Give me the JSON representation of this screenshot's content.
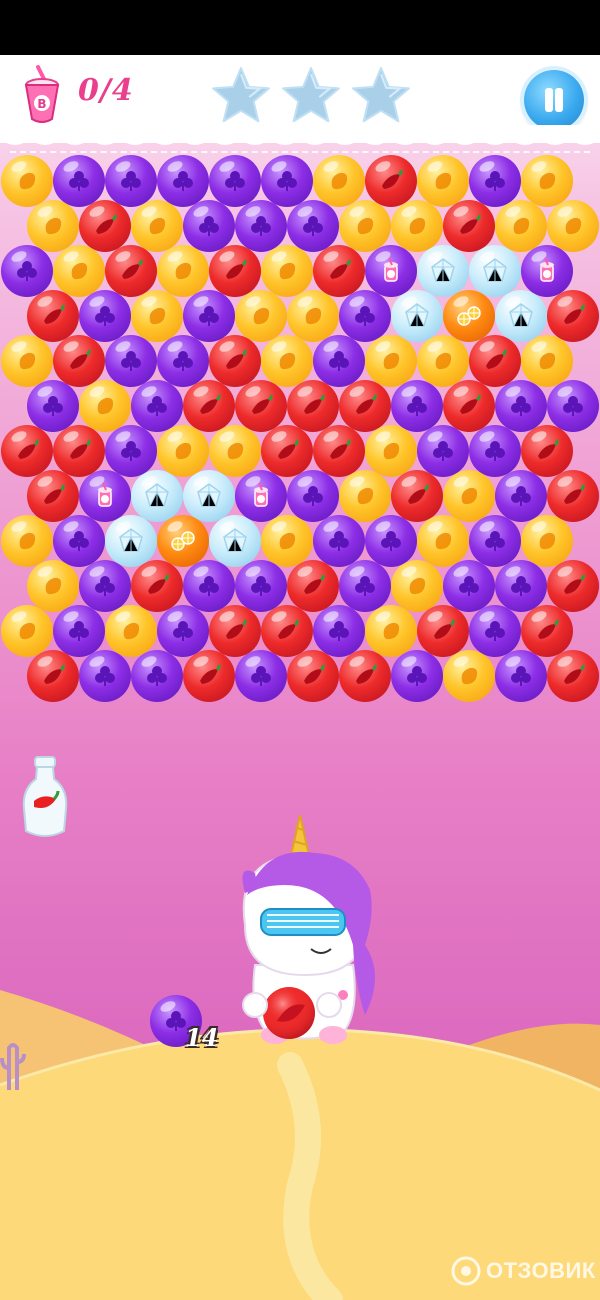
{
  "header": {
    "goal_icon": "milkshake-cup-icon",
    "goal_counter": "0/4",
    "stars": [
      {
        "name": "star-1",
        "filled": false
      },
      {
        "name": "star-2",
        "filled": false
      },
      {
        "name": "star-3",
        "filled": false
      }
    ],
    "pause_icon": "pause-icon"
  },
  "colors": {
    "yellow": "#ffc52a",
    "red": "#ee2b2b",
    "purple": "#8d2ee6",
    "ice": "#c8ecfb",
    "orange": "#ff8a12",
    "star_empty": "#a9cfe9",
    "counter": "#ea3f8c",
    "pause_button": "#3aa9ee"
  },
  "bubble_legend": {
    "Y": "yellow-bubble",
    "R": "red-chili-bubble",
    "P": "purple-clover-bubble",
    "I": "ice-crystal-bubble",
    "M": "milkshake-goal-bubble",
    "O": "orange-bomb-bubble"
  },
  "bubble_rows": [
    "YPPPPPYRYPY",
    "YRYPPPYYRYY",
    "PYRYRYRMIIM",
    "RPYPYYPIOIR",
    "YRPPRYPYYRY",
    "PYPRRRRPRPP",
    "RRPYYRRYPPR",
    "RMIIMPYRYPR",
    "YPIOIYPPYPY",
    "YPRPPRPYPPR",
    "YPYPRRPYRPR",
    "RPPRPRRPYPR"
  ],
  "booster": {
    "icon": "milk-bottle-chili-icon"
  },
  "character": {
    "icon": "unicorn-with-sunglasses-icon",
    "loaded_bubble": "red"
  },
  "next_bubble": {
    "color": "purple"
  },
  "moves_left": "14",
  "watermark": {
    "icon": "otzovik-logo-icon",
    "text": "ОТЗОВИК"
  }
}
